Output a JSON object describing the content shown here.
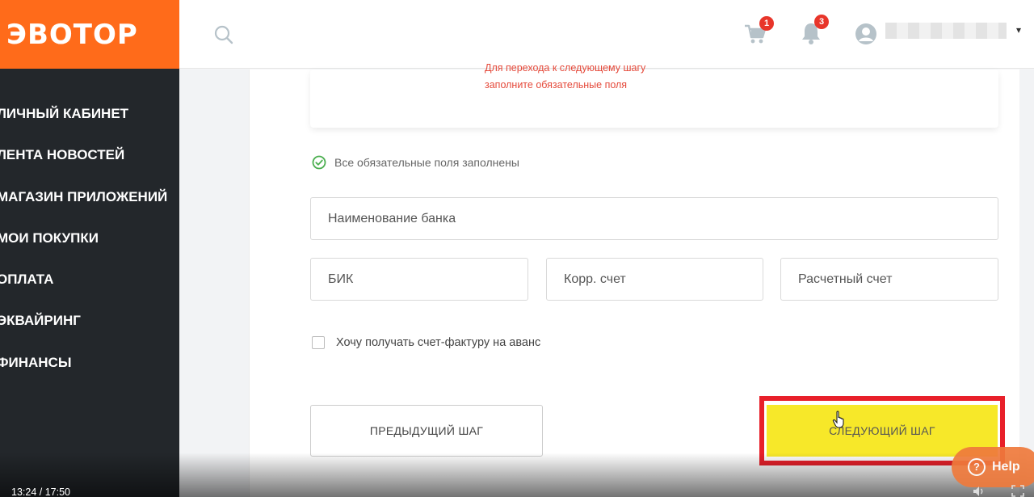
{
  "brand": {
    "logo_text": "ЭВОТОР",
    "logo_color": "#ff6b1a"
  },
  "sidebar": {
    "items": [
      {
        "label": "ЛИЧНЫЙ КАБИНЕТ"
      },
      {
        "label": "ЛЕНТА НОВОСТЕЙ"
      },
      {
        "label": "МАГАЗИН ПРИЛОЖЕНИЙ"
      },
      {
        "label": "МОИ ПОКУПКИ"
      },
      {
        "label": "ОПЛАТА"
      },
      {
        "label": "ЭКВАЙРИНГ"
      },
      {
        "label": "ФИНАНСЫ"
      }
    ]
  },
  "header": {
    "cart_count": "1",
    "notifications_count": "3",
    "icons": [
      "search-icon",
      "cart-icon",
      "bell-icon",
      "user-icon"
    ]
  },
  "form": {
    "error_message": "Для перехода к следующему шагу заполните обязательные поля",
    "status_message": "Все обязательные поля заполнены",
    "fields": {
      "bank_name": "Наименование банка",
      "bik": "БИК",
      "korr": "Корр. счет",
      "account": "Расчетный счет"
    },
    "invoice_checkbox_label": "Хочу получать счет-фактуру на аванс",
    "prev_button": "ПРЕДЫДУЩИЙ ШАГ",
    "next_button": "СЛЕДУЮЩИЙ ШАГ"
  },
  "overlay": {
    "video_time": "13:24 / 17:50",
    "help_label": "Help"
  },
  "colors": {
    "sidebar_bg": "#23272b",
    "accent_orange": "#ff6b1a",
    "next_button_bg": "#f7e829",
    "highlight_frame": "#e8202a",
    "error_red": "#e5493a",
    "success_green": "#4caf50"
  }
}
